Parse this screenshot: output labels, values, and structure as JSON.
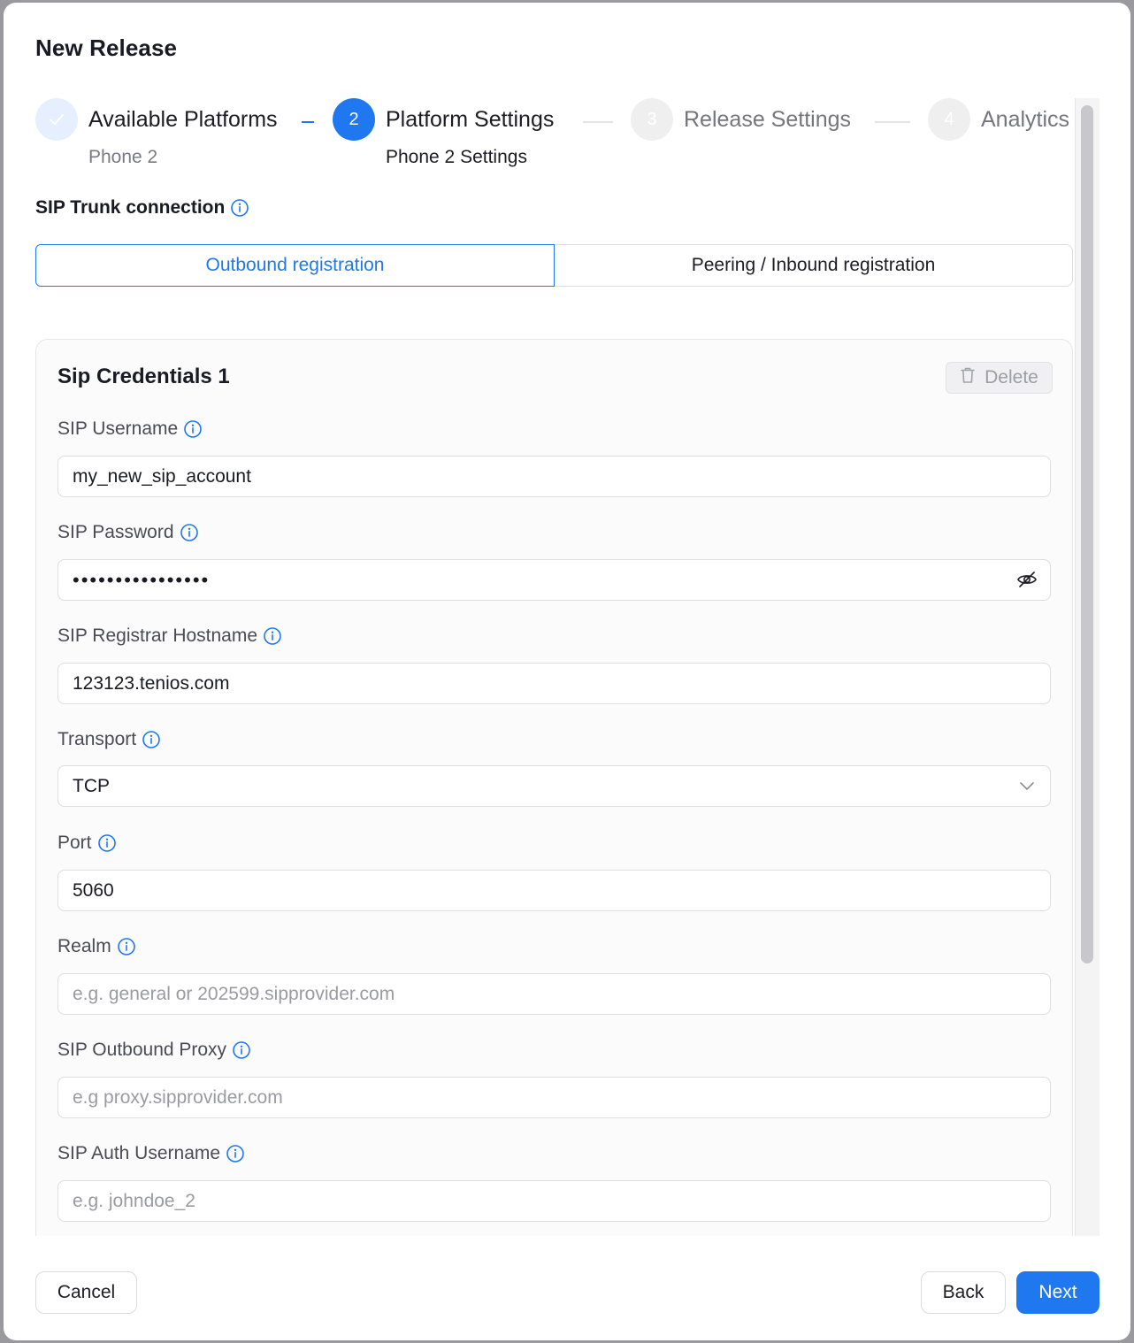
{
  "dialog": {
    "title": "New Release"
  },
  "stepper": {
    "steps": [
      {
        "number": "",
        "label": "Available Platforms",
        "sub": "Phone 2",
        "state": "done"
      },
      {
        "number": "2",
        "label": "Platform Settings",
        "sub": "Phone 2 Settings",
        "state": "active"
      },
      {
        "number": "3",
        "label": "Release Settings",
        "sub": "",
        "state": "todo"
      },
      {
        "number": "4",
        "label": "Analytics",
        "sub": "",
        "state": "todo"
      }
    ]
  },
  "sip_trunk": {
    "heading": "SIP Trunk connection",
    "options": [
      {
        "label": "Outbound registration",
        "selected": true
      },
      {
        "label": "Peering / Inbound registration",
        "selected": false
      }
    ]
  },
  "credentials": {
    "title": "Sip Credentials 1",
    "delete_label": "Delete",
    "fields": {
      "username": {
        "label": "SIP Username",
        "value": "my_new_sip_account",
        "placeholder": ""
      },
      "password": {
        "label": "SIP Password",
        "value": "••••••••••••••••",
        "placeholder": ""
      },
      "registrar": {
        "label": "SIP Registrar Hostname",
        "value": "123123.tenios.com",
        "placeholder": ""
      },
      "transport": {
        "label": "Transport",
        "value": "TCP"
      },
      "port": {
        "label": "Port",
        "value": "5060",
        "placeholder": ""
      },
      "realm": {
        "label": "Realm",
        "value": "",
        "placeholder": "e.g. general or 202599.sipprovider.com"
      },
      "outbound_proxy": {
        "label": "SIP Outbound Proxy",
        "value": "",
        "placeholder": "e.g proxy.sipprovider.com"
      },
      "auth_username": {
        "label": "SIP Auth Username",
        "value": "",
        "placeholder": "e.g. johndoe_2"
      }
    }
  },
  "footer": {
    "cancel": "Cancel",
    "back": "Back",
    "next": "Next"
  },
  "colors": {
    "accent": "#1f78f0",
    "done_circle": "#e5efff",
    "todo_circle": "#efefef"
  }
}
